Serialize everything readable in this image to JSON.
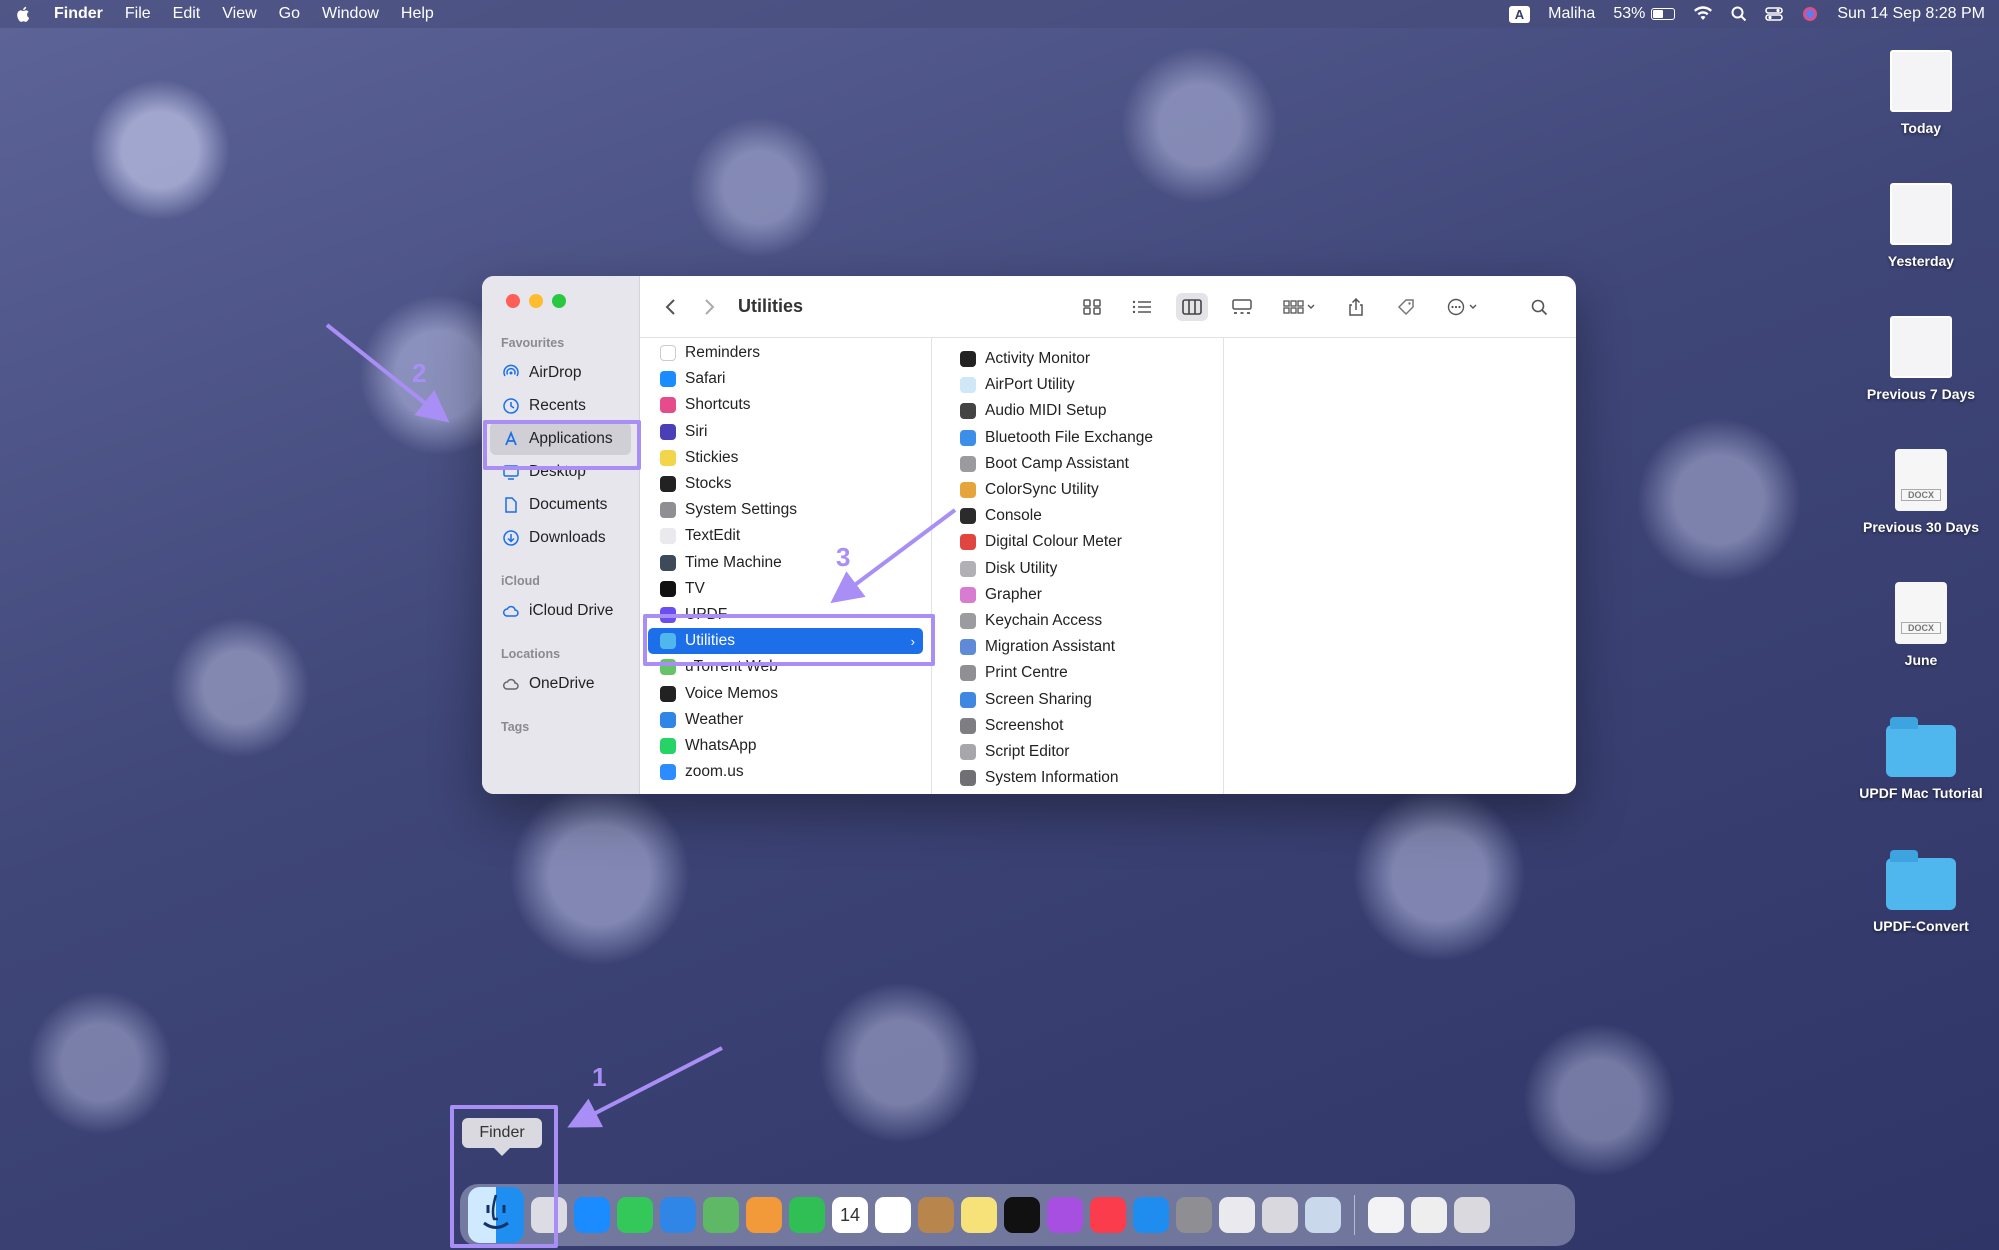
{
  "menubar": {
    "app_name": "Finder",
    "items": [
      "File",
      "Edit",
      "View",
      "Go",
      "Window",
      "Help"
    ],
    "input_badge": "A",
    "user": "Maliha",
    "battery": "53%",
    "battery_level": 0.53,
    "datetime": "Sun 14 Sep  8:28 PM"
  },
  "window": {
    "title": "Utilities",
    "sidebar": {
      "favourites_label": "Favourites",
      "favourites": [
        "AirDrop",
        "Recents",
        "Applications",
        "Desktop",
        "Documents",
        "Downloads"
      ],
      "icloud_label": "iCloud",
      "icloud": [
        "iCloud Drive"
      ],
      "locations_label": "Locations",
      "locations": [
        "OneDrive"
      ],
      "tags_label": "Tags",
      "selected": "Applications"
    },
    "applications_column": [
      {
        "name": "Reminders",
        "color": "#ffffff"
      },
      {
        "name": "Safari",
        "color": "#1a8cff"
      },
      {
        "name": "Shortcuts",
        "color": "#e44c8b"
      },
      {
        "name": "Siri",
        "color": "#4b3fb8"
      },
      {
        "name": "Stickies",
        "color": "#f2d54b"
      },
      {
        "name": "Stocks",
        "color": "#222222"
      },
      {
        "name": "System Settings",
        "color": "#8e8e93"
      },
      {
        "name": "TextEdit",
        "color": "#e9e9ee"
      },
      {
        "name": "Time Machine",
        "color": "#3c4a5a"
      },
      {
        "name": "TV",
        "color": "#111111"
      },
      {
        "name": "UPDF",
        "color": "#6b4ef0"
      },
      {
        "name": "Utilities",
        "color": "#4fb6ee",
        "selected": true
      },
      {
        "name": "uTorrent Web",
        "color": "#65c466"
      },
      {
        "name": "Voice Memos",
        "color": "#222222"
      },
      {
        "name": "Weather",
        "color": "#2f86e6"
      },
      {
        "name": "WhatsApp",
        "color": "#25d366"
      },
      {
        "name": "zoom.us",
        "color": "#2d8cff"
      }
    ],
    "utilities_column": [
      {
        "name": "Activity Monitor",
        "color": "#222222"
      },
      {
        "name": "AirPort Utility",
        "color": "#cfe7f7"
      },
      {
        "name": "Audio MIDI Setup",
        "color": "#444444"
      },
      {
        "name": "Bluetooth File Exchange",
        "color": "#3b8fe8"
      },
      {
        "name": "Boot Camp Assistant",
        "color": "#9a9a9f"
      },
      {
        "name": "ColorSync Utility",
        "color": "#e5a53b"
      },
      {
        "name": "Console",
        "color": "#2b2b2b"
      },
      {
        "name": "Digital Colour Meter",
        "color": "#e0463f"
      },
      {
        "name": "Disk Utility",
        "color": "#b0b0b5"
      },
      {
        "name": "Grapher",
        "color": "#d77cd0"
      },
      {
        "name": "Keychain Access",
        "color": "#9b9ba0"
      },
      {
        "name": "Migration Assistant",
        "color": "#5e8ad8"
      },
      {
        "name": "Print Centre",
        "color": "#8f8f94"
      },
      {
        "name": "Screen Sharing",
        "color": "#3f87e0"
      },
      {
        "name": "Screenshot",
        "color": "#7d7d82"
      },
      {
        "name": "Script Editor",
        "color": "#a6a6ab"
      },
      {
        "name": "System Information",
        "color": "#6f6f74"
      }
    ]
  },
  "annotations": {
    "step1": "1",
    "step2": "2",
    "step3": "3",
    "color": "#a98ef5"
  },
  "desktop": {
    "items": [
      {
        "label": "Today",
        "kind": "shot"
      },
      {
        "label": "Yesterday",
        "kind": "shot"
      },
      {
        "label": "Previous 7 Days",
        "kind": "shot"
      },
      {
        "label": "Previous 30 Days",
        "kind": "doc",
        "badge": "DOCX"
      },
      {
        "label": "June",
        "kind": "doc",
        "badge": "DOCX"
      },
      {
        "label": "UPDF Mac Tutorial",
        "kind": "folder"
      },
      {
        "label": "UPDF-Convert",
        "kind": "folder"
      }
    ]
  },
  "dock": {
    "tooltip": "Finder",
    "calendar_day": "14",
    "apps": [
      {
        "name": "launchpad",
        "color": "#dcdce4"
      },
      {
        "name": "safari",
        "color": "#1a8cff"
      },
      {
        "name": "messages",
        "color": "#34c759"
      },
      {
        "name": "mail",
        "color": "#2f86e6"
      },
      {
        "name": "maps",
        "color": "#5fb865"
      },
      {
        "name": "photos",
        "color": "#f29a3a"
      },
      {
        "name": "facetime",
        "color": "#2fbf55"
      },
      {
        "name": "calendar",
        "color": "#ffffff"
      },
      {
        "name": "reminders",
        "color": "#ffffff"
      },
      {
        "name": "notes-brown",
        "color": "#b8864c"
      },
      {
        "name": "notes",
        "color": "#f7e27a"
      },
      {
        "name": "tv",
        "color": "#111111"
      },
      {
        "name": "podcasts",
        "color": "#a64fe0"
      },
      {
        "name": "music",
        "color": "#fa3c4c"
      },
      {
        "name": "app-store",
        "color": "#1f8cf0"
      },
      {
        "name": "system-settings",
        "color": "#8e8e93"
      },
      {
        "name": "chrome",
        "color": "#e9e9ee"
      },
      {
        "name": "preview",
        "color": "#d8d8de"
      },
      {
        "name": "screen-tool",
        "color": "#c9d8ea"
      }
    ],
    "trailing": [
      {
        "name": "document",
        "color": "#f3f3f5"
      },
      {
        "name": "document-2",
        "color": "#eeeeef"
      },
      {
        "name": "trash",
        "color": "#d9d9de"
      }
    ]
  }
}
